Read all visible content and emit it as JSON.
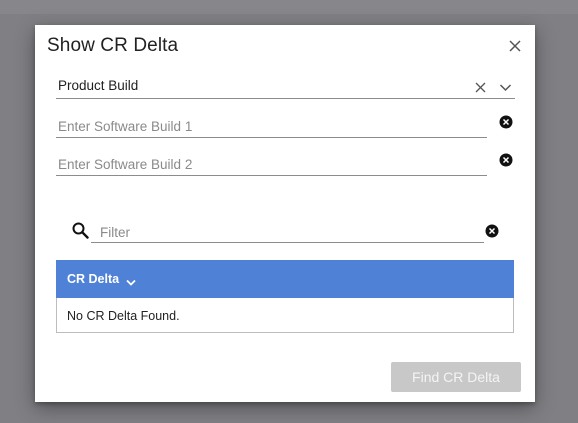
{
  "dialog": {
    "title": "Show CR Delta",
    "close_icon": "close-icon"
  },
  "build_type_select": {
    "selected_value": "Product Build",
    "clear_icon": "clear-x-icon",
    "dropdown_icon": "chevron-down-icon"
  },
  "software_build_1": {
    "value": "",
    "placeholder": "Enter Software Build 1",
    "clear_icon": "clear-circle-icon"
  },
  "software_build_2": {
    "value": "",
    "placeholder": "Enter Software Build 2",
    "clear_icon": "clear-circle-icon"
  },
  "filter": {
    "value": "",
    "placeholder": "Filter",
    "search_icon": "search-icon",
    "clear_icon": "clear-circle-icon"
  },
  "results_table": {
    "column_header": "CR Delta",
    "sort_icon": "chevron-down-icon",
    "empty_message": "No CR Delta Found.",
    "header_color": "#4f82d6"
  },
  "actions": {
    "find_button_label": "Find CR Delta",
    "find_button_enabled": false
  }
}
